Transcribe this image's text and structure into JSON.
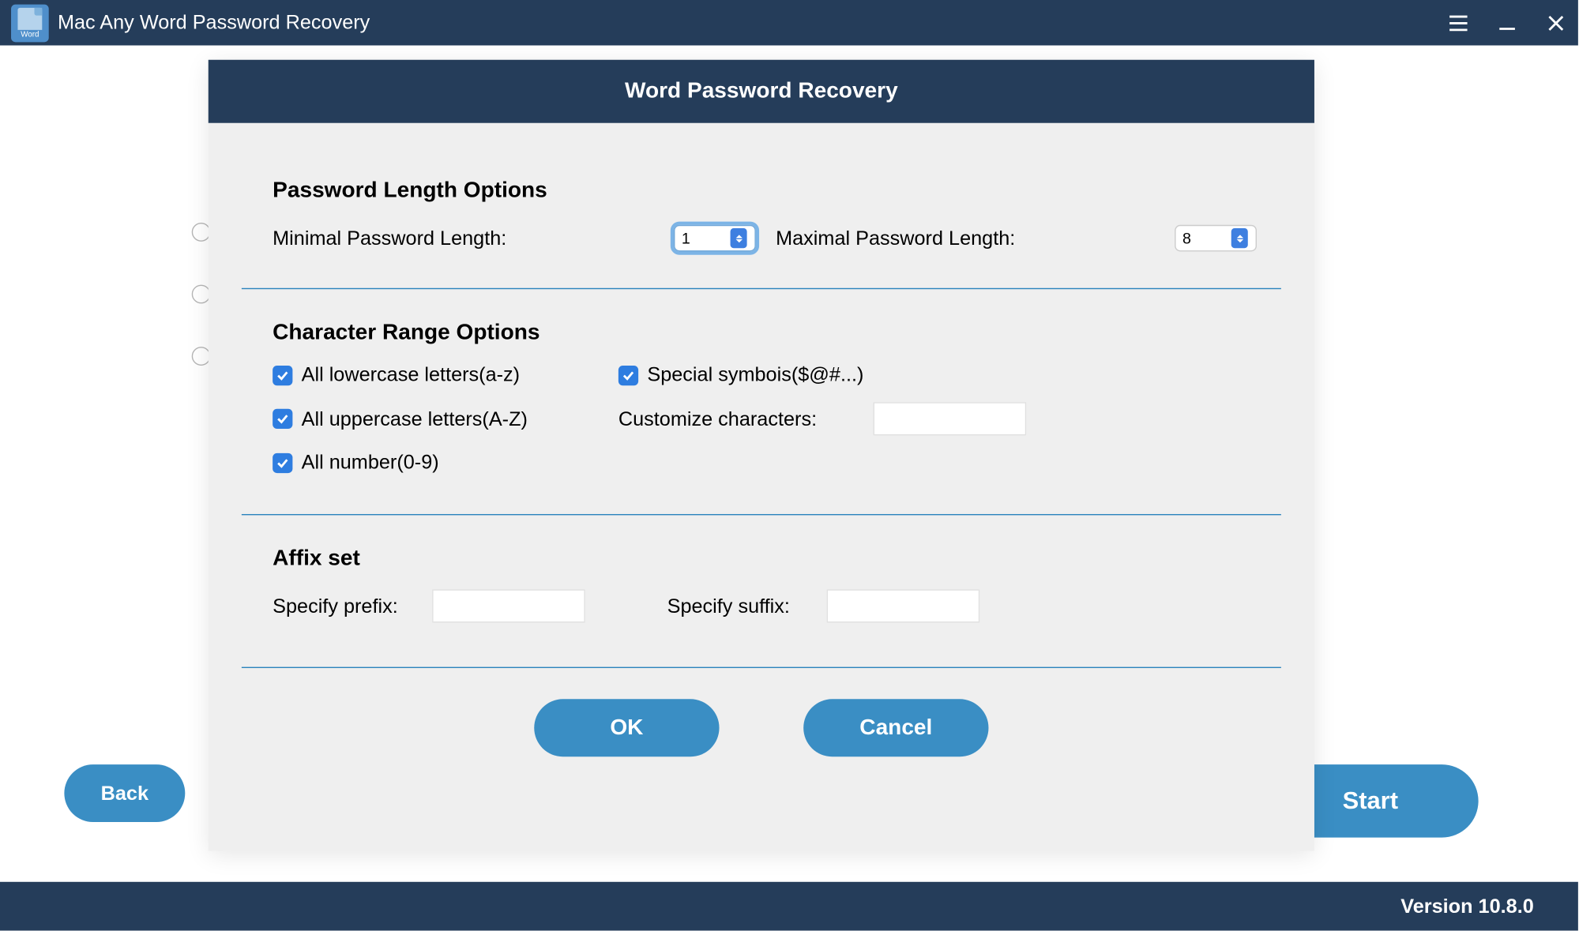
{
  "titlebar": {
    "app_name": "Mac Any Word Password Recovery",
    "icon_label": "Word"
  },
  "main": {
    "back_label": "Back",
    "start_label": "Start"
  },
  "dialog": {
    "title": "Word Password Recovery",
    "length_section": {
      "heading": "Password Length Options",
      "min_label": "Minimal Password Length:",
      "min_value": "1",
      "max_label": "Maximal Password Length:",
      "max_value": "8"
    },
    "char_section": {
      "heading": "Character Range Options",
      "lowercase_label": "All lowercase letters(a-z)",
      "lowercase_checked": true,
      "uppercase_label": "All uppercase letters(A-Z)",
      "uppercase_checked": true,
      "number_label": "All number(0-9)",
      "number_checked": true,
      "special_label": "Special symbois($@#...)",
      "special_checked": true,
      "customize_label": "Customize characters:",
      "customize_value": ""
    },
    "affix_section": {
      "heading": "Affix set",
      "prefix_label": "Specify prefix:",
      "prefix_value": "",
      "suffix_label": "Specify suffix:",
      "suffix_value": ""
    },
    "ok_label": "OK",
    "cancel_label": "Cancel"
  },
  "footer": {
    "version": "Version 10.8.0"
  }
}
